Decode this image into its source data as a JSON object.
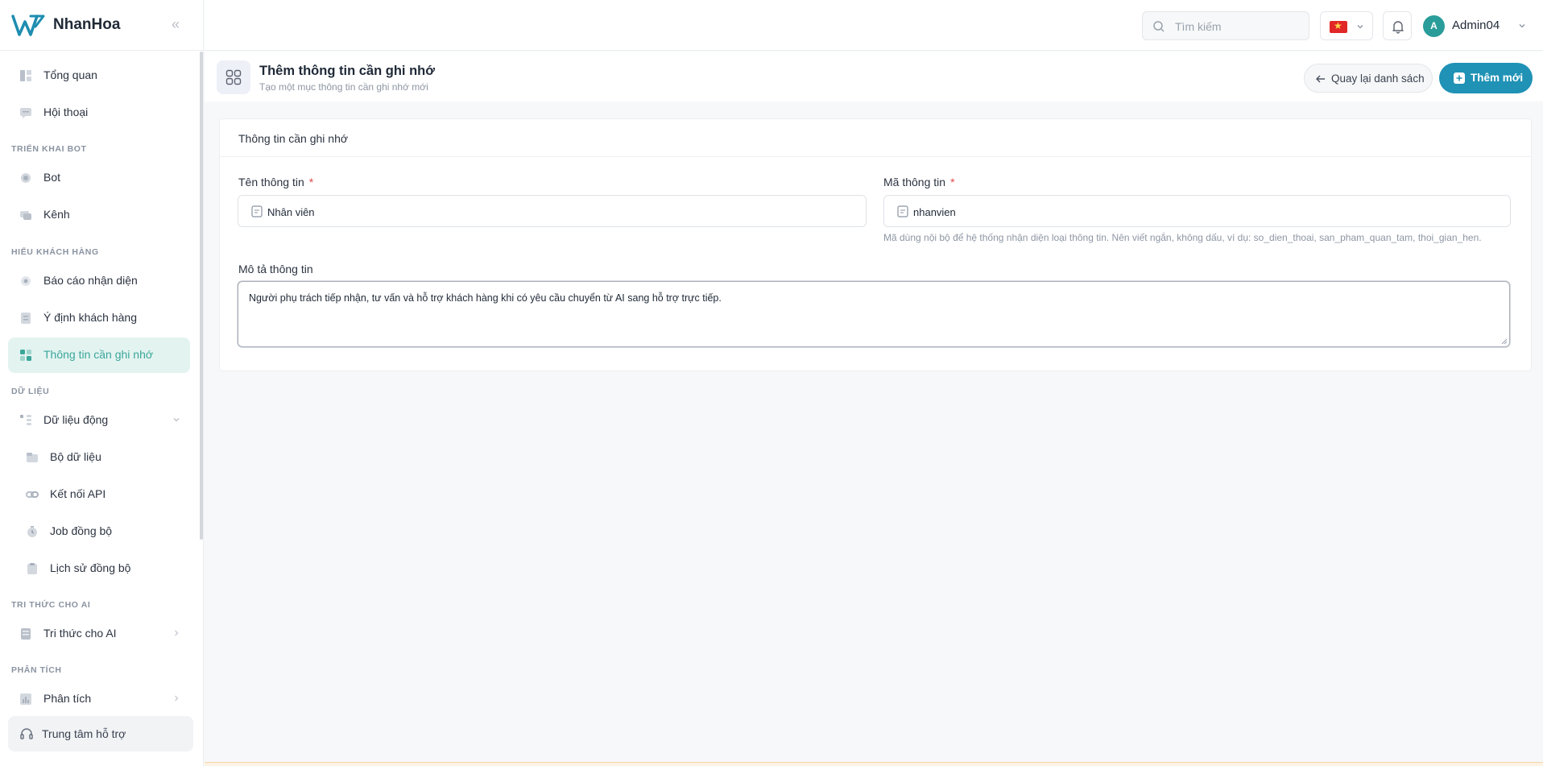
{
  "brand": {
    "name": "NhanHoa"
  },
  "sidebar": {
    "items": [
      {
        "label": "Tổng quan",
        "icon": "dashboard-icon"
      },
      {
        "label": "Hội thoại",
        "icon": "chat-icon"
      }
    ],
    "sections": [
      {
        "title": "TRIỂN KHAI BOT",
        "items": [
          {
            "label": "Bot",
            "icon": "chip-icon"
          },
          {
            "label": "Kênh",
            "icon": "channel-icon"
          }
        ]
      },
      {
        "title": "HIỂU KHÁCH HÀNG",
        "items": [
          {
            "label": "Báo cáo nhận diện",
            "icon": "report-icon"
          },
          {
            "label": "Ý định khách hàng",
            "icon": "intent-icon"
          },
          {
            "label": "Thông tin cần ghi nhớ",
            "icon": "memory-icon"
          }
        ]
      },
      {
        "title": "DỮ LIỆU",
        "items": [
          {
            "label": "Dữ liệu động",
            "icon": "dynamic-data-icon"
          },
          {
            "label": "Bộ dữ liệu",
            "icon": "dataset-icon"
          },
          {
            "label": "Kết nối API",
            "icon": "api-link-icon"
          },
          {
            "label": "Job đồng bộ",
            "icon": "sync-job-icon"
          },
          {
            "label": "Lịch sử đồng bộ",
            "icon": "sync-history-icon"
          }
        ]
      },
      {
        "title": "TRI THỨC CHO AI",
        "items": [
          {
            "label": "Tri thức cho AI",
            "icon": "knowledge-icon"
          }
        ]
      },
      {
        "title": "PHÂN TÍCH",
        "items": [
          {
            "label": "Phân tích",
            "icon": "analytics-icon"
          }
        ]
      }
    ],
    "support_label": "Trung tâm hỗ trợ"
  },
  "topbar": {
    "search_placeholder": "Tìm kiếm",
    "language": "vi",
    "user": {
      "initial": "A",
      "name": "Admin04"
    }
  },
  "page": {
    "title": "Thêm thông tin cần ghi nhớ",
    "subtitle": "Tạo một mục thông tin cần ghi nhớ mới",
    "back_label": "Quay lại danh sách",
    "add_label": "Thêm mới"
  },
  "form": {
    "card_title": "Thông tin cần ghi nhớ",
    "name_label": "Tên thông tin",
    "name_value": "Nhân viên",
    "code_label": "Mã thông tin",
    "code_value": "nhanvien",
    "required_mark": "*",
    "code_hint": "Mã dùng nội bộ để hệ thống nhận diện loại thông tin. Nên viết ngắn, không dấu, ví dụ: so_dien_thoai, san_pham_quan_tam, thoi_gian_hen.",
    "desc_label": "Mô tả thông tin",
    "desc_value": "Người phụ trách tiếp nhận, tư vấn và hỗ trợ khách hàng khi có yêu cầu chuyển từ AI sang hỗ trợ trực tiếp."
  },
  "colors": {
    "primary": "#1f92b5",
    "active_bg": "#e3f3f0",
    "active_text": "#3aa69a",
    "required": "#e5484d"
  }
}
